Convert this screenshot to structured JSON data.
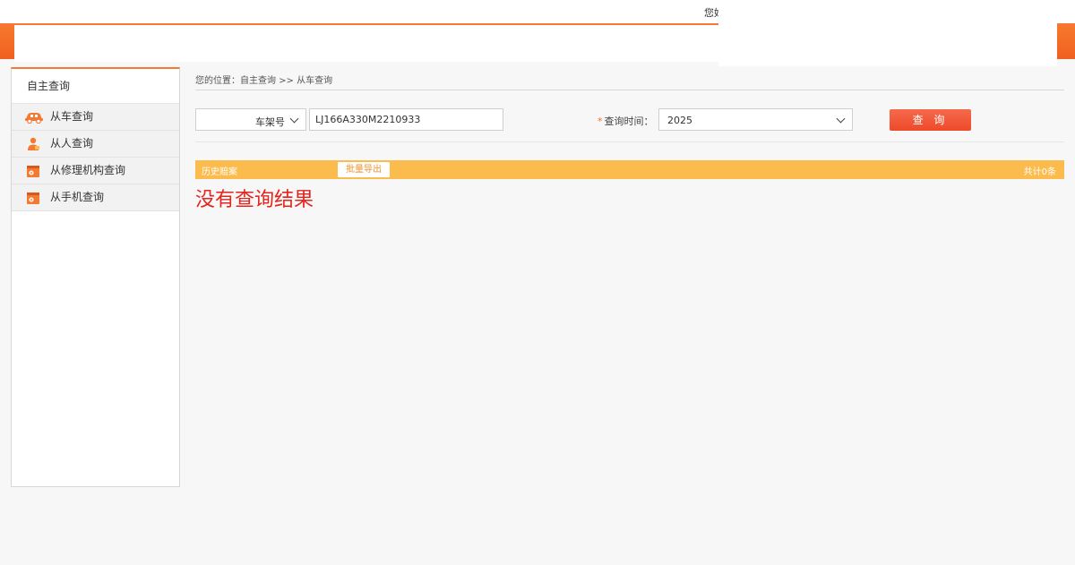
{
  "header": {
    "greeting": "您好"
  },
  "sidebar": {
    "title": "自主查询",
    "items": [
      {
        "label": "从车查询",
        "icon": "car-icon"
      },
      {
        "label": "从人查询",
        "icon": "person-icon"
      },
      {
        "label": "从修理机构查询",
        "icon": "repair-shop-icon"
      },
      {
        "label": "从手机查询",
        "icon": "phone-query-icon"
      }
    ]
  },
  "main": {
    "breadcrumb": "您的位置：自主查询 >> 从车查询",
    "search": {
      "type_selected": "车架号",
      "vin_value": "LJ166A330M2210933",
      "time_label": "查询时间：",
      "time_required_mark": "*",
      "time_selected": "2025",
      "query_button": "查 询"
    },
    "results": {
      "bar_title": "历史赔案",
      "export_button": "批量导出",
      "count_text": "共计0条",
      "empty_message": "没有查询结果"
    }
  },
  "colors": {
    "brand_orange": "#f47a34",
    "result_bar": "#fbbc4d",
    "query_button": "#ee4a2a",
    "empty_message": "#e3251e"
  }
}
